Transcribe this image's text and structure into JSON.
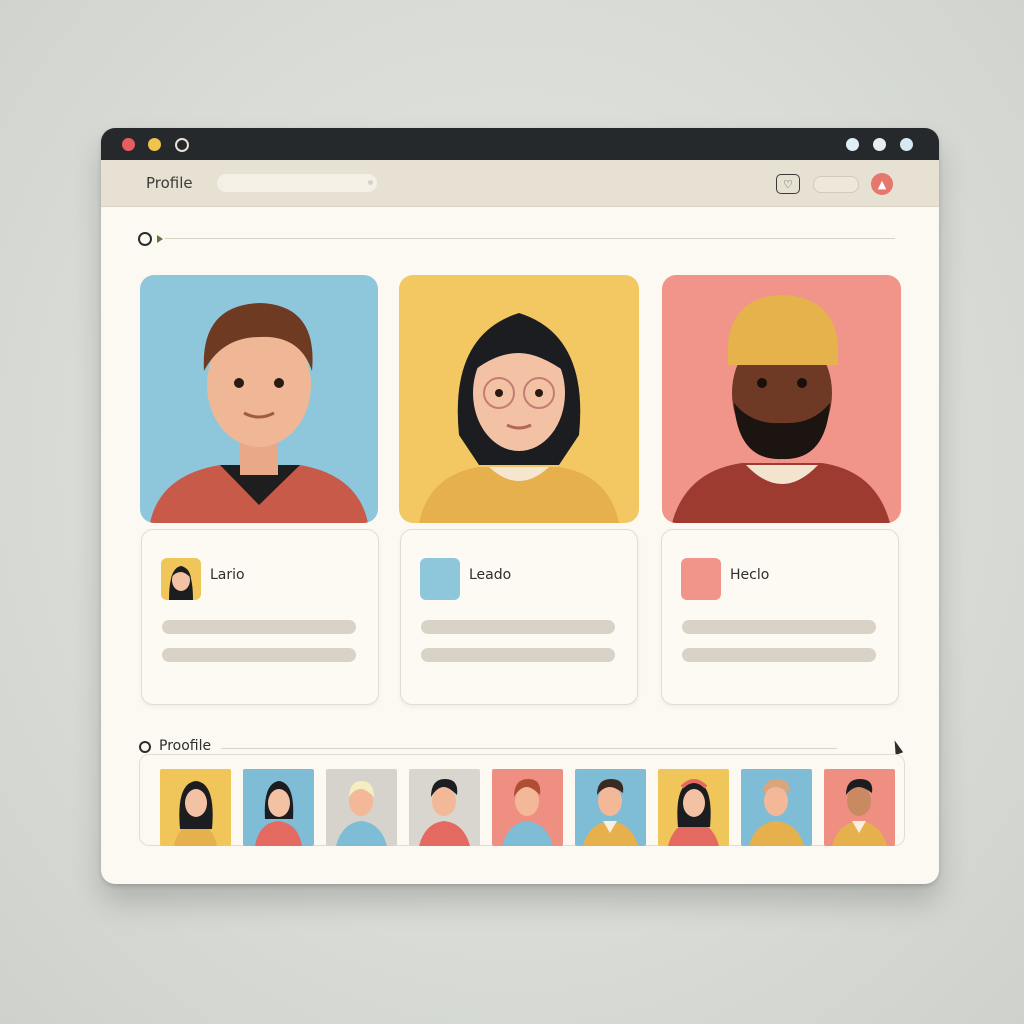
{
  "window": {
    "toolbar": {
      "title": "Profile"
    }
  },
  "featured": [
    {
      "name": "Lario",
      "bg": "#8ec7dc",
      "accent": "#c85a4a"
    },
    {
      "name": "Leado",
      "bg": "#f3c762",
      "accent": "#e6b04c"
    },
    {
      "name": "Heclo",
      "bg": "#f1958a",
      "accent": "#9e3b30"
    }
  ],
  "strip": {
    "title": "Proofile",
    "thumbnails": [
      {
        "bg": "#f0c55a"
      },
      {
        "bg": "#7fbcd6"
      },
      {
        "bg": "#d6d3cc"
      },
      {
        "bg": "#d9d6cf"
      },
      {
        "bg": "#ee8f82"
      },
      {
        "bg": "#7fbcd6"
      },
      {
        "bg": "#f0c55a"
      },
      {
        "bg": "#7fbcd6"
      },
      {
        "bg": "#ee8f82"
      }
    ]
  }
}
